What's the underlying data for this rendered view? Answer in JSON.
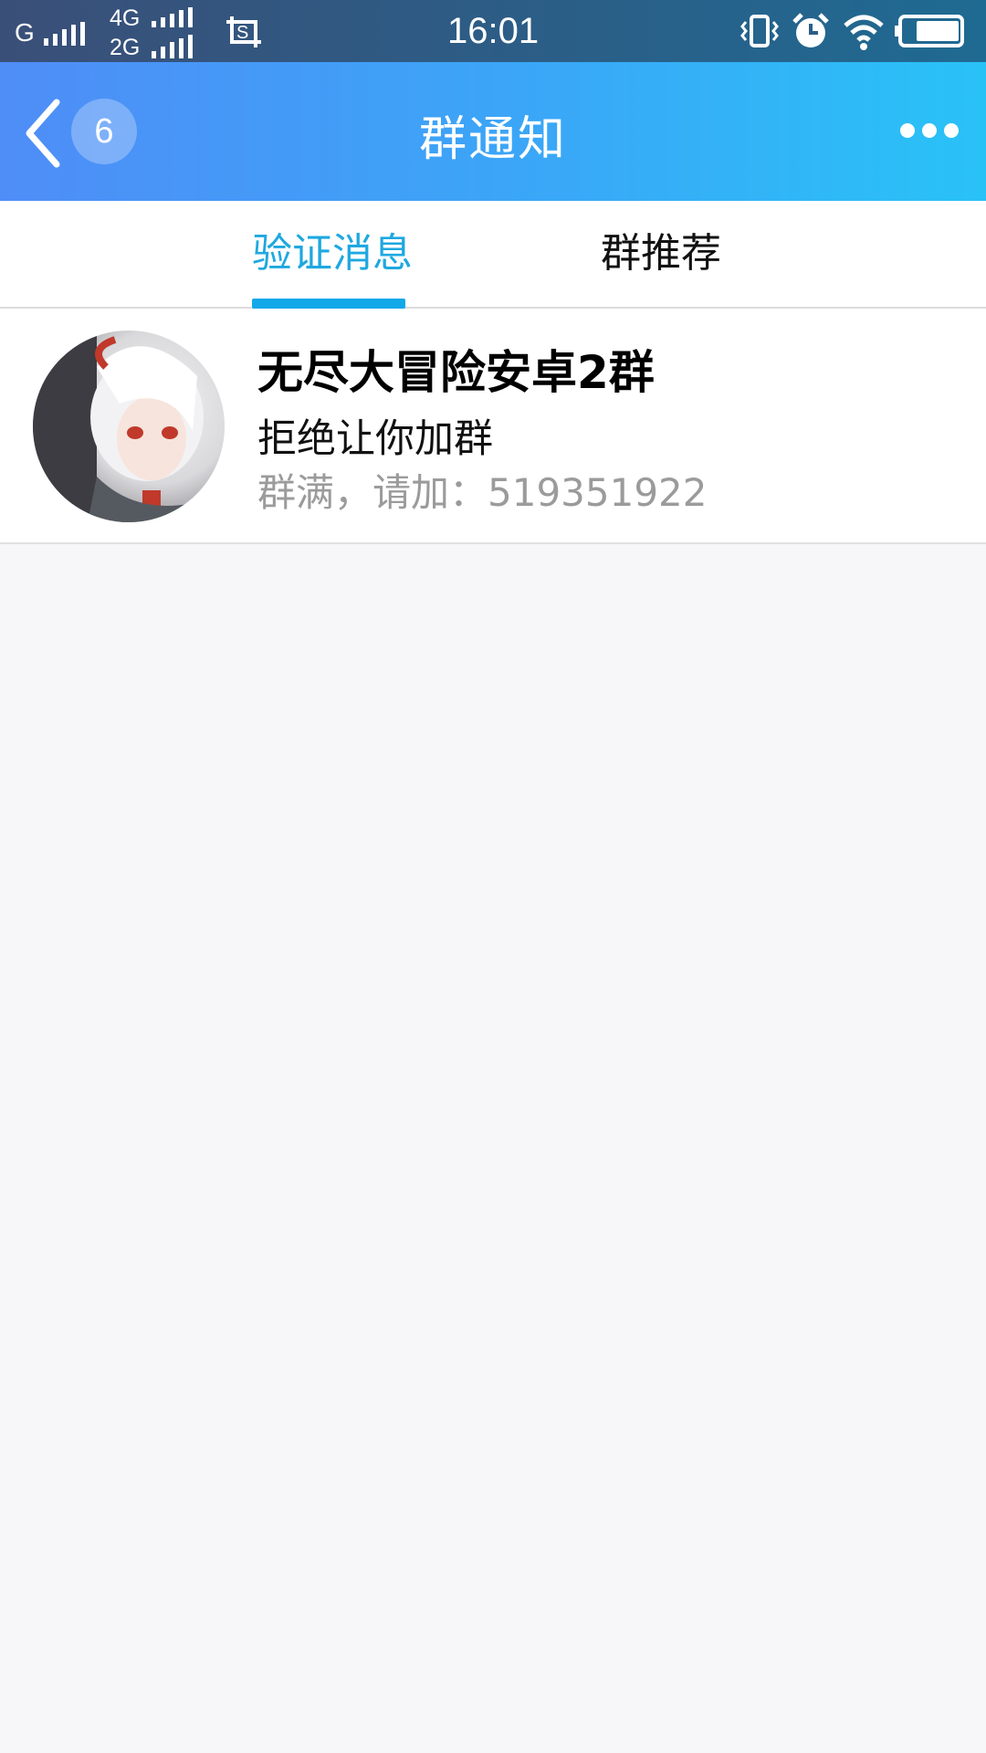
{
  "status_bar": {
    "carrier1": "G",
    "net_top": "4G",
    "net_bottom": "2G",
    "time": "16:01",
    "icons": [
      "signal-icon",
      "screenshot-icon",
      "vibrate-icon",
      "alarm-icon",
      "wifi-icon",
      "battery-icon"
    ]
  },
  "header": {
    "back_count": "6",
    "title": "群通知",
    "back_icon": "chevron-left-icon",
    "more_icon": "more-dots-icon"
  },
  "tabs": [
    {
      "label": "验证消息",
      "active": true
    },
    {
      "label": "群推荐",
      "active": false
    }
  ],
  "notification": {
    "group_name": "无尽大冒险安卓2群",
    "status": "拒绝让你加群",
    "note": "群满，请加：519351922"
  },
  "colors": {
    "accent": "#1ea8e0",
    "header_start": "#4f8df7",
    "header_end": "#29c2f7",
    "background": "#f7f7f9"
  }
}
